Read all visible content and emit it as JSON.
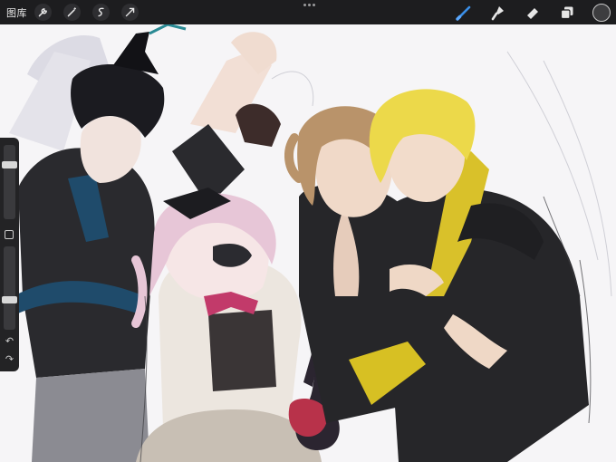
{
  "toolbar": {
    "gallery_label": "图库",
    "left_tools": [
      "wrench-icon",
      "magic-wand-icon",
      "selection-icon",
      "transform-icon"
    ],
    "right_tools": [
      "brush-icon",
      "smudge-icon",
      "eraser-icon",
      "layers-icon"
    ],
    "active_tool": "brush",
    "active_color": "#3d3d3f",
    "accent": "#3a8ee6"
  },
  "sidebar": {
    "brush_size": 0.76,
    "opacity": 0.35
  }
}
